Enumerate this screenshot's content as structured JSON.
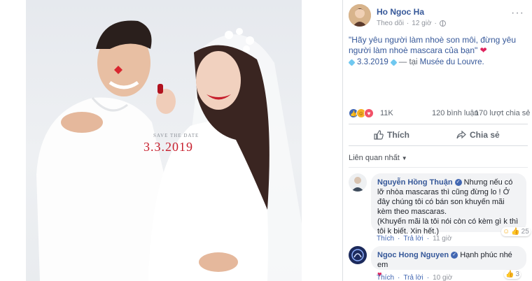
{
  "photo": {
    "save_the_date": "SAVE THE DATE",
    "date": "3.3.2019"
  },
  "post": {
    "author": "Ho Ngoc Ha",
    "follow_label": "Theo dõi",
    "time": "12 giờ",
    "text": "\"Hãy yêu người làm nhoè son môi, đừng yêu người làm nhoè mascara của bạn\"",
    "date_line": "3.3.2019",
    "location_prefix": "— tại",
    "location": "Musée du Louvre.",
    "reaction_count": "11K",
    "comments_count": "120 bình luận",
    "shares_count": "170 lượt chia sẻ"
  },
  "actions": {
    "like_label": "Thích",
    "share_label": "Chia sẻ"
  },
  "related_label": "Liên quan nhất",
  "comments": [
    {
      "name": "Nguyễn Hồng Thuận",
      "text": "Nhưng nếu có lỡ nhòa mascaras thì cũng đừng lo ! Ở đây chúng tôi có bán son khuyến mãi kèm theo mascaras.",
      "text2": "(Khuyến mãi là tôi nói còn có kèm gì k thì tôi k biết. Xin hết.)",
      "reactions": "25",
      "like_label": "Thích",
      "reply_label": "Trả lời",
      "time": "11 giờ"
    },
    {
      "name": "Ngoc Hong Nguyen",
      "text": "Hạnh phúc nhé em",
      "reactions": "3",
      "like_label": "Thích",
      "reply_label": "Trả lời",
      "time": "10 giờ"
    }
  ],
  "colors": {
    "link": "#365899",
    "heart": "#e0245e",
    "like_blue": "#4267b2"
  }
}
